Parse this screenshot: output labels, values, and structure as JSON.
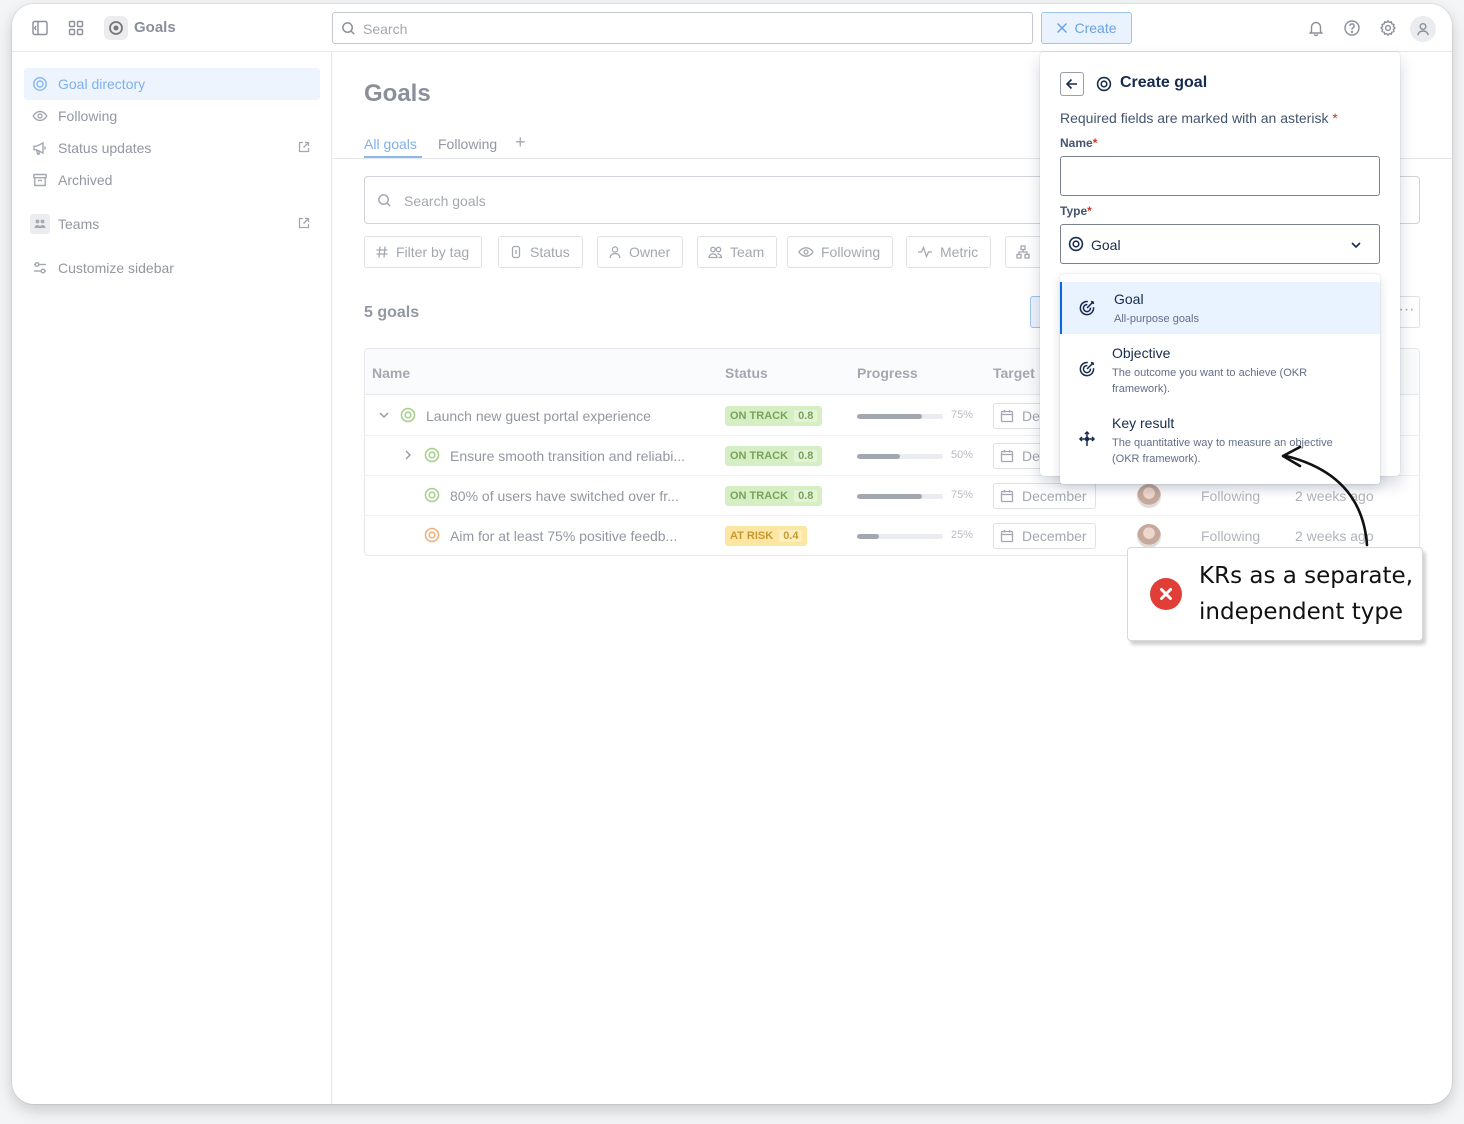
{
  "topbar": {
    "app_title": "Goals",
    "search_placeholder": "Search",
    "create_label": "Create"
  },
  "sidebar": {
    "items": [
      {
        "label": "Goal directory",
        "icon": "goal-icon"
      },
      {
        "label": "Following",
        "icon": "eye-icon"
      },
      {
        "label": "Status updates",
        "icon": "megaphone-icon"
      },
      {
        "label": "Archived",
        "icon": "archive-icon"
      },
      {
        "label": "Teams",
        "icon": "teams-icon"
      },
      {
        "label": "Customize sidebar",
        "icon": "customize-icon"
      }
    ]
  },
  "main": {
    "title": "Goals",
    "tabs": [
      {
        "label": "All goals"
      },
      {
        "label": "Following"
      }
    ],
    "goal_search_placeholder": "Search goals",
    "filters": [
      {
        "label": "Filter by tag"
      },
      {
        "label": "Status"
      },
      {
        "label": "Owner"
      },
      {
        "label": "Team"
      },
      {
        "label": "Following"
      },
      {
        "label": "Metric"
      }
    ],
    "goal_count": "5 goals",
    "columns": [
      {
        "label": "Name"
      },
      {
        "label": "Status"
      },
      {
        "label": "Progress"
      },
      {
        "label": "Target"
      }
    ],
    "rows": [
      {
        "name": "Launch new guest portal experience",
        "status": "ON TRACK",
        "score": "0.8",
        "progress": 0.75,
        "progress_label": "75%",
        "target": "De",
        "following": "",
        "updated": ""
      },
      {
        "name": "Ensure smooth transition and reliabi...",
        "status": "ON TRACK",
        "score": "0.8",
        "progress": 0.5,
        "progress_label": "50%",
        "target": "De",
        "following": "",
        "updated": ""
      },
      {
        "name": "80% of users have switched over fr...",
        "status": "ON TRACK",
        "score": "0.8",
        "progress": 0.75,
        "progress_label": "75%",
        "target": "December",
        "following": "Following",
        "updated": "2 weeks ago"
      },
      {
        "name": "Aim for at least 75% positive feedb...",
        "status": "AT RISK",
        "score": "0.4",
        "progress": 0.25,
        "progress_label": "25%",
        "target": "December",
        "following": "Following",
        "updated": "2 weeks ago"
      }
    ],
    "colors": {
      "on_track": "#d6eec4",
      "at_risk": "#fde6a1",
      "accent": "#0c66e4"
    }
  },
  "create_goal": {
    "title": "Create goal",
    "required_note": "Required fields are marked with an asterisk",
    "asterisk": "*",
    "name_label": "Name",
    "name_value": "",
    "type_label": "Type",
    "type_value": "Goal",
    "options": [
      {
        "title": "Goal",
        "desc": "All-purpose goals",
        "icon": "goal-target-icon",
        "selected": true
      },
      {
        "title": "Objective",
        "desc": "The outcome you want to achieve (OKR framework).",
        "icon": "objective-target-icon",
        "selected": false
      },
      {
        "title": "Key result",
        "desc": "The quantitative way to measure an objective (OKR framework).",
        "icon": "key-result-icon",
        "selected": false
      }
    ]
  },
  "annotation": {
    "text": "KRs as a separate, independent type",
    "badge_color": "#e03e36"
  }
}
